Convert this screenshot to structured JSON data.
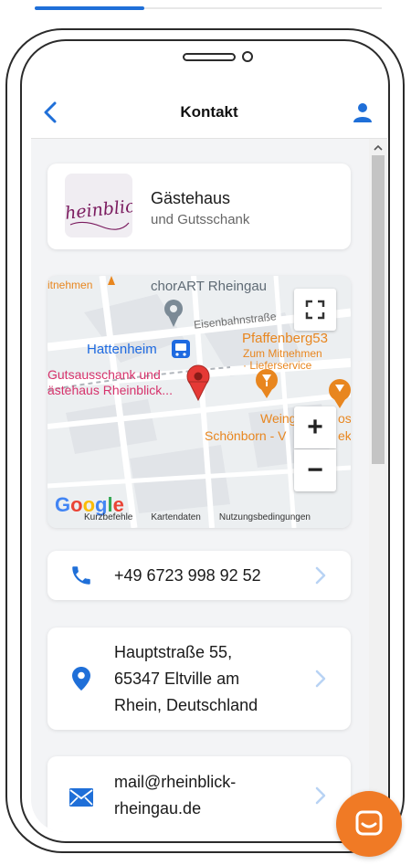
{
  "header": {
    "title": "Kontakt"
  },
  "business": {
    "logo_text": "Rheinblick",
    "name": "Gästehaus",
    "subtitle": "und Gutsschank"
  },
  "map": {
    "labels": {
      "mitnehmen": "itnehmen",
      "chorart": "chorART Rheingau",
      "street": "Eisenbahnstraße",
      "hattenheim": "Hattenheim",
      "pfaffenberg": "Pfaffenberg53",
      "zum_mitnehmen": "Zum Mitnehmen",
      "lieferservice": "· Lieferservice",
      "gutsausschank": "Gutsausschank und",
      "gaestehaus": "ästehaus Rheinblick...",
      "weingut": "Weingu",
      "weingut_end": "os",
      "schoenborn": "Schönborn - V",
      "schoenborn_end": "ek",
      "google": "Google"
    },
    "zoom_in": "+",
    "zoom_out": "−",
    "footer": {
      "shortcuts": "Kurzbefehle",
      "map_data": "Kartendaten",
      "terms": "Nutzungsbedingungen"
    }
  },
  "contact": {
    "phone": "+49 6723 998 92 52",
    "address_line1": "Hauptstraße 55,",
    "address_line2": "65347 Eltville am",
    "address_line3": "Rhein, Deutschland",
    "email_line1": "mail@rheinblick-",
    "email_line2": "rheingau.de"
  },
  "colors": {
    "accent": "#1f6fd8",
    "fab": "#f07a25",
    "logo": "#7a1a5e",
    "map_pin": "#e53935",
    "map_poi_orange": "#e8861f",
    "map_label_pink": "#d6336c"
  },
  "icons": {
    "back": "chevron-left-icon",
    "profile": "user-icon",
    "phone": "phone-icon",
    "location": "location-pin-icon",
    "email": "envelope-icon",
    "chevron": "chevron-right-icon",
    "fullscreen": "fullscreen-icon",
    "chat": "chat-icon"
  }
}
